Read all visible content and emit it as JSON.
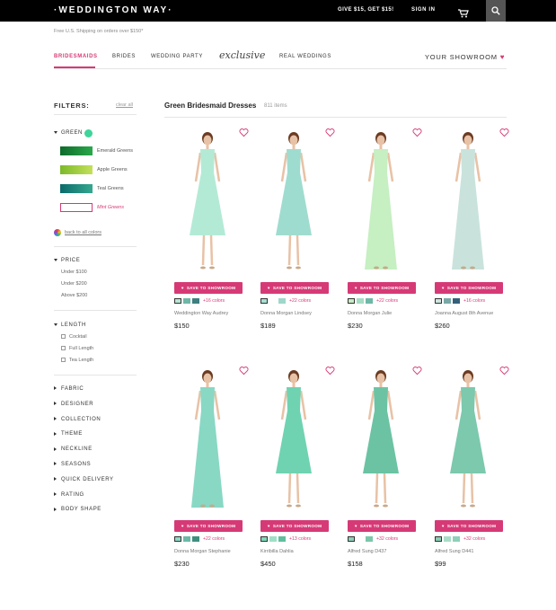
{
  "header": {
    "logo": "·WEDDINGTON WAY·",
    "promo": "GIVE $15, GET $15!",
    "signin": "SIGN IN",
    "cart_icon": "cart-icon",
    "search_icon": "search-icon"
  },
  "shipping_note": "Free U.S. Shipping on orders over $150*",
  "nav": {
    "items": [
      "BRIDESMAIDS",
      "BRIDES",
      "WEDDING PARTY",
      "exclusive",
      "REAL WEDDINGS"
    ],
    "active": "BRIDESMAIDS",
    "showroom": "YOUR SHOWROOM"
  },
  "filters": {
    "title": "FILTERS:",
    "clear_all": "clear all",
    "color_group": "GREEN",
    "color_options": [
      {
        "label": "Emerald Greens",
        "from": "#0e6b2c",
        "to": "#2aa84a",
        "selected": false
      },
      {
        "label": "Apple Greens",
        "from": "#7cba2a",
        "to": "#c4e05a",
        "selected": false
      },
      {
        "label": "Teal Greens",
        "from": "#0b6b6b",
        "to": "#35a890",
        "selected": false
      },
      {
        "label": "Mint Greens",
        "from": "#ffffff",
        "to": "#ffffff",
        "selected": true
      }
    ],
    "back_to_colors": "back to all colors",
    "price": {
      "title": "PRICE",
      "options": [
        "Under $100",
        "Under $200",
        "Above $200"
      ]
    },
    "length": {
      "title": "LENGTH",
      "options": [
        "Cocktail",
        "Full Length",
        "Tea Length"
      ]
    },
    "collapsed": [
      "FABRIC",
      "DESIGNER",
      "COLLECTION",
      "THEME",
      "NECKLINE",
      "SEASONS",
      "QUICK DELIVERY",
      "RATING",
      "BODY SHAPE"
    ]
  },
  "results": {
    "title": "Green Bridesmaid Dresses",
    "count": "811 items",
    "save_label": "SAVE TO SHOWROOM",
    "products": [
      {
        "name": "Weddington Way Audrey",
        "price": "$150",
        "more": "+16 colors",
        "dress": "#b3ead6",
        "swatches": [
          "#b7e6d4",
          "#6fb7a7",
          "#3f7f7f"
        ]
      },
      {
        "name": "Donna Morgan Lindsey",
        "price": "$189",
        "more": "+22 colors",
        "dress": "#9fdcd0",
        "swatches": [
          "#a8e0d2",
          "#ffffff",
          "#9fd7c9"
        ]
      },
      {
        "name": "Donna Morgan Julie",
        "price": "$230",
        "more": "+22 colors",
        "dress": "#c6efc2",
        "swatches": [
          "#c8ecc4",
          "#a4dcc4",
          "#6fb7a7"
        ]
      },
      {
        "name": "Joanna August 8th Avenue",
        "price": "$260",
        "more": "+16 colors",
        "dress": "#c9e3dc",
        "swatches": [
          "#cfe6df",
          "#7aa8a8",
          "#35607a"
        ]
      },
      {
        "name": "Donna Morgan Stephanie",
        "price": "$230",
        "more": "+22 colors",
        "dress": "#88d8c4",
        "swatches": [
          "#8fd9c5",
          "#6db8a7",
          "#3f8f7f"
        ]
      },
      {
        "name": "Kirribilla Dahlia",
        "price": "$450",
        "more": "+13 colors",
        "dress": "#6fd3b2",
        "swatches": [
          "#7fd8b8",
          "#9fdfc6",
          "#5fbf9c"
        ]
      },
      {
        "name": "Alfred Sung D437",
        "price": "$158",
        "more": "+32 colors",
        "dress": "#6cc3a4",
        "swatches": [
          "#8fd0b8",
          "#ffffff",
          "#7bc7a9"
        ]
      },
      {
        "name": "Alfred Sung D441",
        "price": "$99",
        "more": "+32 colors",
        "dress": "#7cc9ad",
        "swatches": [
          "#8cccb5",
          "#a9dcc7",
          "#8fd0b8"
        ]
      }
    ]
  }
}
